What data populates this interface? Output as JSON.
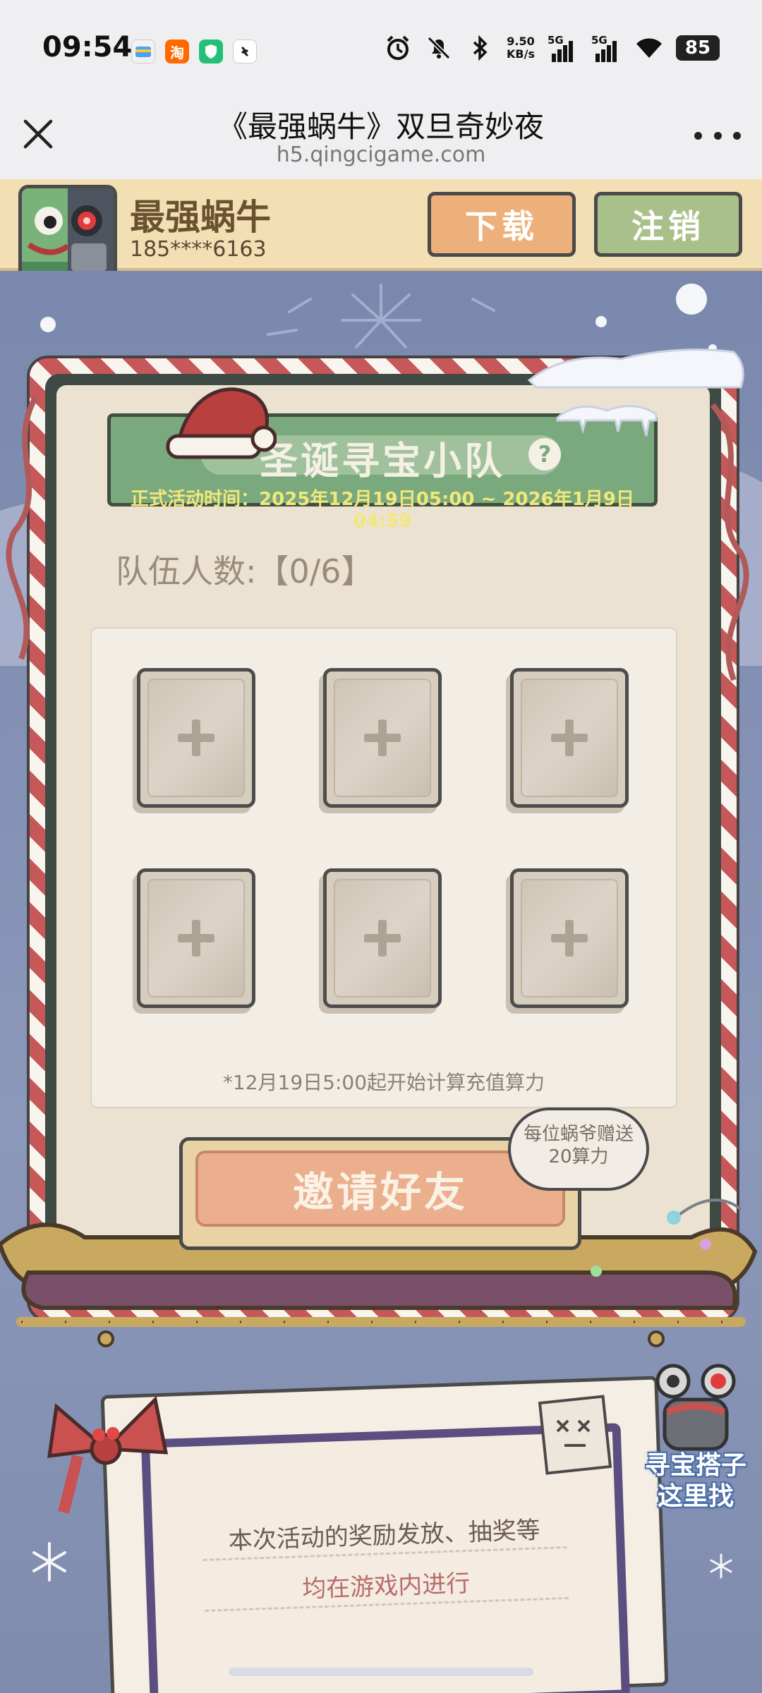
{
  "status_bar": {
    "time": "09:54",
    "net_speed_value": "9.50",
    "net_speed_unit": "KB/s",
    "signal1_label": "5G",
    "signal2_label": "5G",
    "battery": "85",
    "taobao_glyph": "淘"
  },
  "browser": {
    "title": "《最强蜗牛》双旦奇妙夜",
    "url": "h5.qingcigame.com"
  },
  "account": {
    "game_name": "最强蜗牛",
    "phone": "185****6163",
    "download_label": "下载",
    "logout_label": "注销"
  },
  "event": {
    "title": "圣诞寻宝小队",
    "help_glyph": "?",
    "time_text": "正式活动时间：2025年12月19日05:00 ~ 2026年1月9日04:59",
    "team_count": "队伍人数:【0/6】",
    "slots": [
      {
        "state": "empty"
      },
      {
        "state": "empty"
      },
      {
        "state": "empty"
      },
      {
        "state": "empty"
      },
      {
        "state": "empty"
      },
      {
        "state": "empty"
      }
    ],
    "recharge_note": "*12月19日5:00起开始计算充值算力",
    "invite_label": "邀请好友",
    "bonus_line1": "每位蜗爷赠送",
    "bonus_line2": "20算力"
  },
  "notice": {
    "line1": "本次活动的奖励发放、抽奖等",
    "line2": "均在游戏内进行"
  },
  "finder": {
    "line1": "寻宝搭子",
    "line2": "这里找"
  },
  "colors": {
    "account_bar": "#f3dfb4",
    "download_btn": "#eeb07a",
    "logout_btn": "#a9c08a",
    "banner_green": "#7aa97e",
    "invite_btn": "#ebaf8d",
    "stage_bg": "#8390b2"
  },
  "icons": [
    "close-icon",
    "more-icon",
    "alarm-icon",
    "mute-icon",
    "bluetooth-icon",
    "wifi-icon",
    "help-icon",
    "plus-icon"
  ]
}
